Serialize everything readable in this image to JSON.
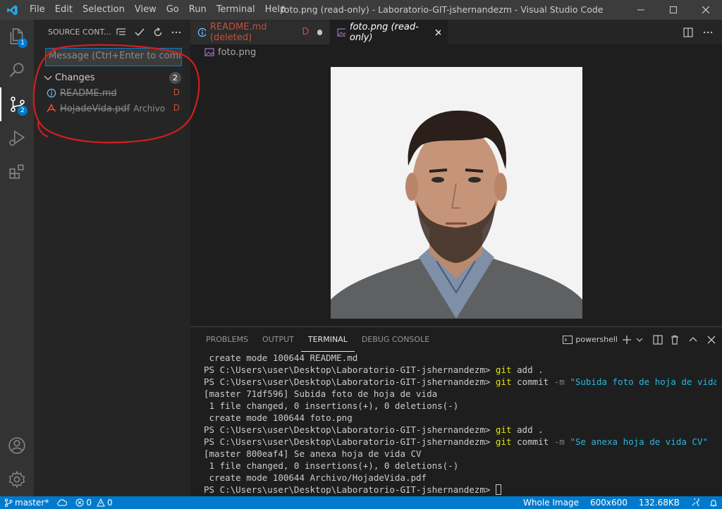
{
  "titlebar": {
    "menu": [
      "File",
      "Edit",
      "Selection",
      "View",
      "Go",
      "Run",
      "Terminal",
      "Help"
    ],
    "title": "foto.png (read-only) - Laboratorio-GIT-jshernandezm - Visual Studio Code"
  },
  "activity": {
    "explorer_badge": "1",
    "scm_badge": "2"
  },
  "sidebar": {
    "title": "SOURCE CONT...",
    "message_placeholder": "Message (Ctrl+Enter to commi...",
    "changes_label": "Changes",
    "changes_count": "2",
    "files": [
      {
        "name": "README.md",
        "desc": "",
        "status": "D"
      },
      {
        "name": "HojadeVida.pdf",
        "desc": "Archivo",
        "status": "D"
      }
    ]
  },
  "tabs": [
    {
      "label": "README.md (deleted)",
      "status": "D"
    },
    {
      "label": "foto.png (read-only)"
    }
  ],
  "breadcrumb": "foto.png",
  "panel": {
    "tabs": [
      "PROBLEMS",
      "OUTPUT",
      "TERMINAL",
      "DEBUG CONSOLE"
    ],
    "terminal_select": "powershell",
    "lines": {
      "l1": " create mode 100644 README.md",
      "prompt": "PS C:\\Users\\user\\Desktop\\Laboratorio-GIT-jshernandezm>",
      "git": "git",
      "add": "add .",
      "commit": "commit",
      "m_flag": "-m",
      "msg1": "\"Subida foto de hoja de vida\"",
      "l4": "[master 71df596] Subida foto de hoja de vida",
      "l5": " 1 file changed, 0 insertions(+), 0 deletions(-)",
      "l6": " create mode 100644 foto.png",
      "msg2": "\"Se anexa hoja de vida CV\"",
      "l9": "[master 800eaf4] Se anexa hoja de vida CV",
      "l10": " 1 file changed, 0 insertions(+), 0 deletions(-)",
      "l11": " create mode 100644 Archivo/HojadeVida.pdf"
    }
  },
  "status": {
    "branch": "master*",
    "errors": "0",
    "warnings": "0",
    "view": "Whole Image",
    "dims": "600x600",
    "size": "132.68KB"
  },
  "colors": {
    "accent": "#007acc",
    "deleted": "#c74e39",
    "annotation": "#d11f1f"
  }
}
